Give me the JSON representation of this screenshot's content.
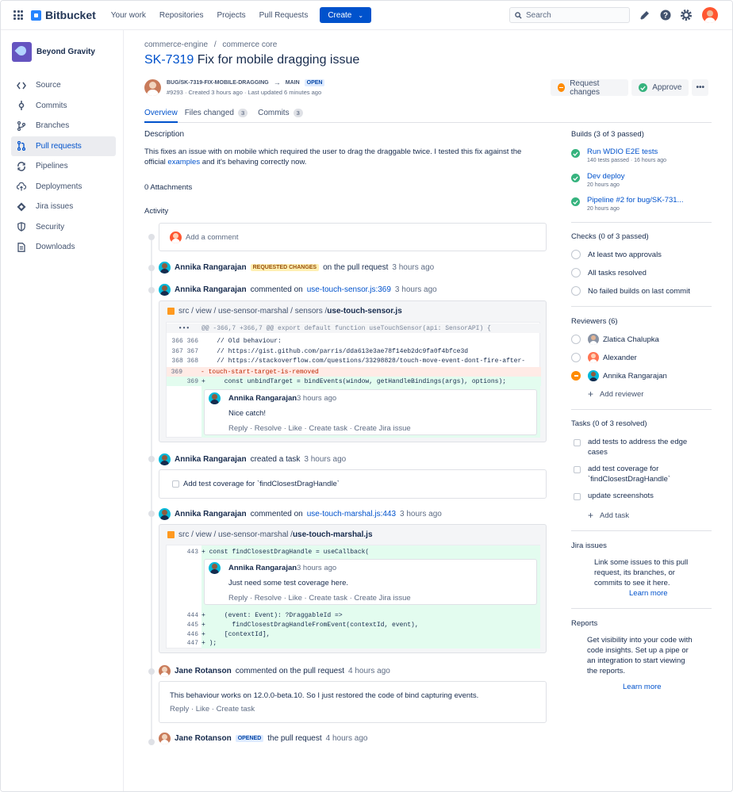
{
  "topnav": {
    "product": "Bitbucket",
    "links": [
      "Your work",
      "Repositories",
      "Projects",
      "Pull Requests"
    ],
    "create_label": "Create",
    "search_placeholder": "Search"
  },
  "sidebar": {
    "project_name": "Beyond Gravity",
    "items": [
      {
        "label": "Source",
        "icon": "code-icon"
      },
      {
        "label": "Commits",
        "icon": "commit-icon"
      },
      {
        "label": "Branches",
        "icon": "branch-icon"
      },
      {
        "label": "Pull requests",
        "icon": "pull-request-icon",
        "active": true
      },
      {
        "label": "Pipelines",
        "icon": "pipeline-icon"
      },
      {
        "label": "Deployments",
        "icon": "deploy-icon"
      },
      {
        "label": "Jira issues",
        "icon": "jira-icon"
      },
      {
        "label": "Security",
        "icon": "shield-icon"
      },
      {
        "label": "Downloads",
        "icon": "document-icon"
      }
    ]
  },
  "pr": {
    "breadcrumb": [
      "commerce-engine",
      "/",
      "commerce core"
    ],
    "key": "SK-7319",
    "title": "Fix for mobile dragging issue",
    "source_branch": "BUG/SK-7319-FIX-MOBILE-DRAGGING",
    "arrow": "→",
    "target_branch": "MAIN",
    "status": "OPEN",
    "meta": "#9293 · Created 3 hours ago · Last updated 6 minutes ago",
    "request_changes_label": "Request changes",
    "approve_label": "Approve",
    "more_label": "•••"
  },
  "tabs": [
    {
      "label": "Overview",
      "count": ""
    },
    {
      "label": "Files changed",
      "count": "3"
    },
    {
      "label": "Commits",
      "count": "3"
    }
  ],
  "overview": {
    "description_heading": "Description",
    "description_1": "This fixes an issue with on mobile which required the user to drag the draggable twice. I tested this fix against the",
    "description_2a": "official ",
    "description_link": "examples",
    "description_2b": " and it's behaving correctly now.",
    "attachments": "0 Attachments",
    "activity_heading": "Activity",
    "add_comment_placeholder": "Add a comment"
  },
  "activity": {
    "ev1": {
      "name": "Annika Rangarajan",
      "badge": "REQUESTED CHANGES",
      "text": "on the pull request",
      "time": "3 hours ago"
    },
    "ev2": {
      "name": "Annika Rangarajan",
      "text": "commented on",
      "link": "use-touch-sensor.js:369",
      "time": "3 hours ago"
    },
    "file1": {
      "path": "src / view / use-sensor-marshal / sensors / ",
      "file": "use-touch-sensor.js"
    },
    "diff1": {
      "hunk_ellipsis": "•••",
      "hunk": "@@ -366,7 +366,7 @@ export default function useTouchSensor(api: SensorAPI) {",
      "l1n": "366 366",
      "l1": "    // Old behaviour:",
      "l2n": "367 367",
      "l2": "    // https://gist.github.com/parris/dda613e3ae78f14eb2dc9fa0f4bfce3d",
      "l3n": "368 368",
      "l3": "    // https://stackoverflow.com/questions/33298828/touch-move-event-dont-fire-after-",
      "l4n": "369",
      "l4": "- touch-start-target-is-removed",
      "l5n": "369",
      "l5": "+     const unbindTarget = bindEvents(window, getHandleBindings(args), options);"
    },
    "inline1": {
      "name": "Annika Rangarajan",
      "time": "3 hours ago",
      "text": "Nice catch!",
      "actions": "Reply · Resolve · Like · Create task · Create Jira issue"
    },
    "ev3": {
      "name": "Annika Rangarajan",
      "text": "created a task",
      "time": "3 hours ago"
    },
    "task_text": "Add test coverage for `findClosestDragHandle`",
    "ev4": {
      "name": "Annika Rangarajan",
      "text": "commented on",
      "link": "use-touch-marshal.js:443",
      "time": "3 hours ago"
    },
    "file2": {
      "path": "src / view / use-sensor-marshal / ",
      "file": "use-touch-marshal.js"
    },
    "diff2": {
      "l1n": "443",
      "l1": "+ const findClosestDragHandle = useCallback(",
      "l2n": "444",
      "l2": "+     (event: Event): ?DraggableId =>",
      "l3n": "445",
      "l3": "+       findClosestDragHandleFromEvent(contextId, event),",
      "l4n": "446",
      "l4": "+     [contextId],",
      "l5n": "447",
      "l5": "+ );"
    },
    "inline2": {
      "name": "Annika Rangarajan",
      "time": "3 hours ago",
      "text": "Just need some test coverage here.",
      "actions": "Reply · Resolve · Like · Create task · Create Jira issue"
    },
    "ev5": {
      "name": "Jane Rotanson",
      "text": "commented on the pull request",
      "time": "4 hours ago"
    },
    "comment5": {
      "text": "This behaviour works on 12.0.0-beta.10. So I just restored the code of bind capturing events.",
      "actions": "Reply · Like · Create task"
    },
    "ev6": {
      "name": "Jane Rotanson",
      "badge": "OPENED",
      "text": "the pull request",
      "time": "4 hours ago"
    }
  },
  "right": {
    "builds_heading": "Builds (3 of 3 passed)",
    "builds": [
      {
        "name": "Run WDIO E2E tests",
        "sub": "140 tests passed · 16 hours ago"
      },
      {
        "name": "Dev deploy",
        "sub": "20 hours ago"
      },
      {
        "name": "Pipeline #2 for bug/SK-731...",
        "sub": "20 hours ago"
      }
    ],
    "checks_heading": "Checks (0 of 3 passed)",
    "checks": [
      "At least two approvals",
      "All tasks resolved",
      "No failed builds on last commit"
    ],
    "reviewers_heading": "Reviewers (6)",
    "reviewers": [
      "Zlatica Chalupka",
      "Alexander",
      "Annika Rangarajan"
    ],
    "add_reviewer": "Add reviewer",
    "tasks_heading": "Tasks (0 of 3 resolved)",
    "tasks": [
      {
        "l1": "add tests to address the edge",
        "l2": "cases"
      },
      {
        "l1": "add test coverage for",
        "l2": "`findClosestDragHandle`"
      },
      {
        "l1": "update screenshots",
        "l2": ""
      }
    ],
    "add_task": "Add task",
    "jira_heading": "Jira issues",
    "jira_text": [
      "Link some issues to this pull",
      "request, its branches, or",
      "commits to see it here."
    ],
    "jira_link": "Learn more",
    "reports_heading": "Reports",
    "reports_text": [
      "Get visibility into your code with",
      "code insights. Set up a pipe or",
      "an integration to start viewing",
      "the reports."
    ],
    "reports_link": "Learn more"
  }
}
